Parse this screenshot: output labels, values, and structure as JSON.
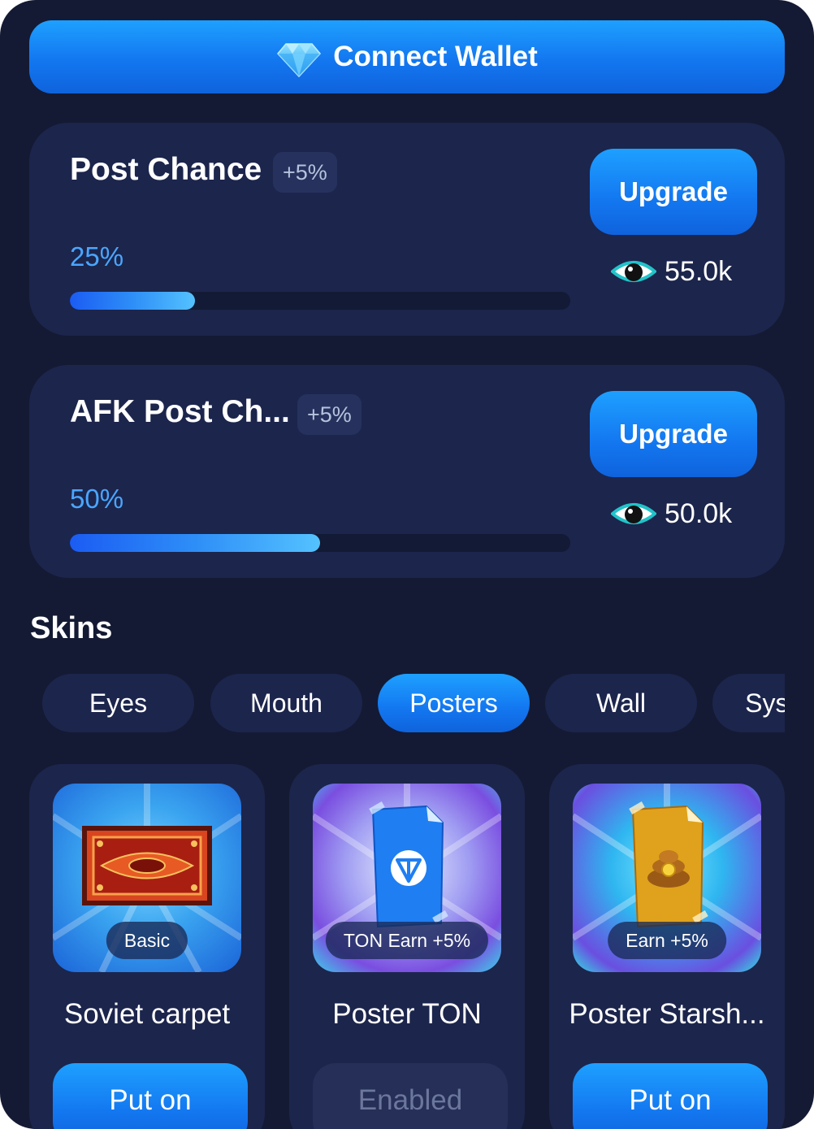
{
  "wallet": {
    "label": "Connect Wallet",
    "icon": "diamond-gem-icon"
  },
  "upgrades": [
    {
      "title": "Post Chance",
      "bonus": "+5%",
      "percent_label": "25%",
      "progress": 0.25,
      "button_label": "Upgrade",
      "price": "55.0k",
      "price_icon": "eye-icon"
    },
    {
      "title": "AFK Post Ch...",
      "bonus": "+5%",
      "percent_label": "50%",
      "progress": 0.5,
      "button_label": "Upgrade",
      "price": "50.0k",
      "price_icon": "eye-icon"
    }
  ],
  "skins": {
    "title": "Skins",
    "tabs": [
      {
        "label": "Eyes",
        "active": false
      },
      {
        "label": "Mouth",
        "active": false
      },
      {
        "label": "Posters",
        "active": true
      },
      {
        "label": "Wall",
        "active": false
      },
      {
        "label": "System",
        "active": false
      }
    ],
    "items": [
      {
        "name": "Soviet carpet",
        "badge": "Basic",
        "button_label": "Put on",
        "button_state": "enabled",
        "icon": "carpet-icon"
      },
      {
        "name": "Poster TON",
        "badge": "TON Earn +5%",
        "button_label": "Enabled",
        "button_state": "disabled",
        "icon": "ton-poster-icon"
      },
      {
        "name": "Poster Starsh...",
        "badge": "Earn +5%",
        "button_label": "Put on",
        "button_state": "enabled",
        "icon": "poop-poster-icon"
      }
    ]
  },
  "colors": {
    "background": "#141a33",
    "card": "#1c254c",
    "accent": "#1377f0",
    "percent_text": "#4aa6ff",
    "eye_iris": "#22c3c9"
  }
}
